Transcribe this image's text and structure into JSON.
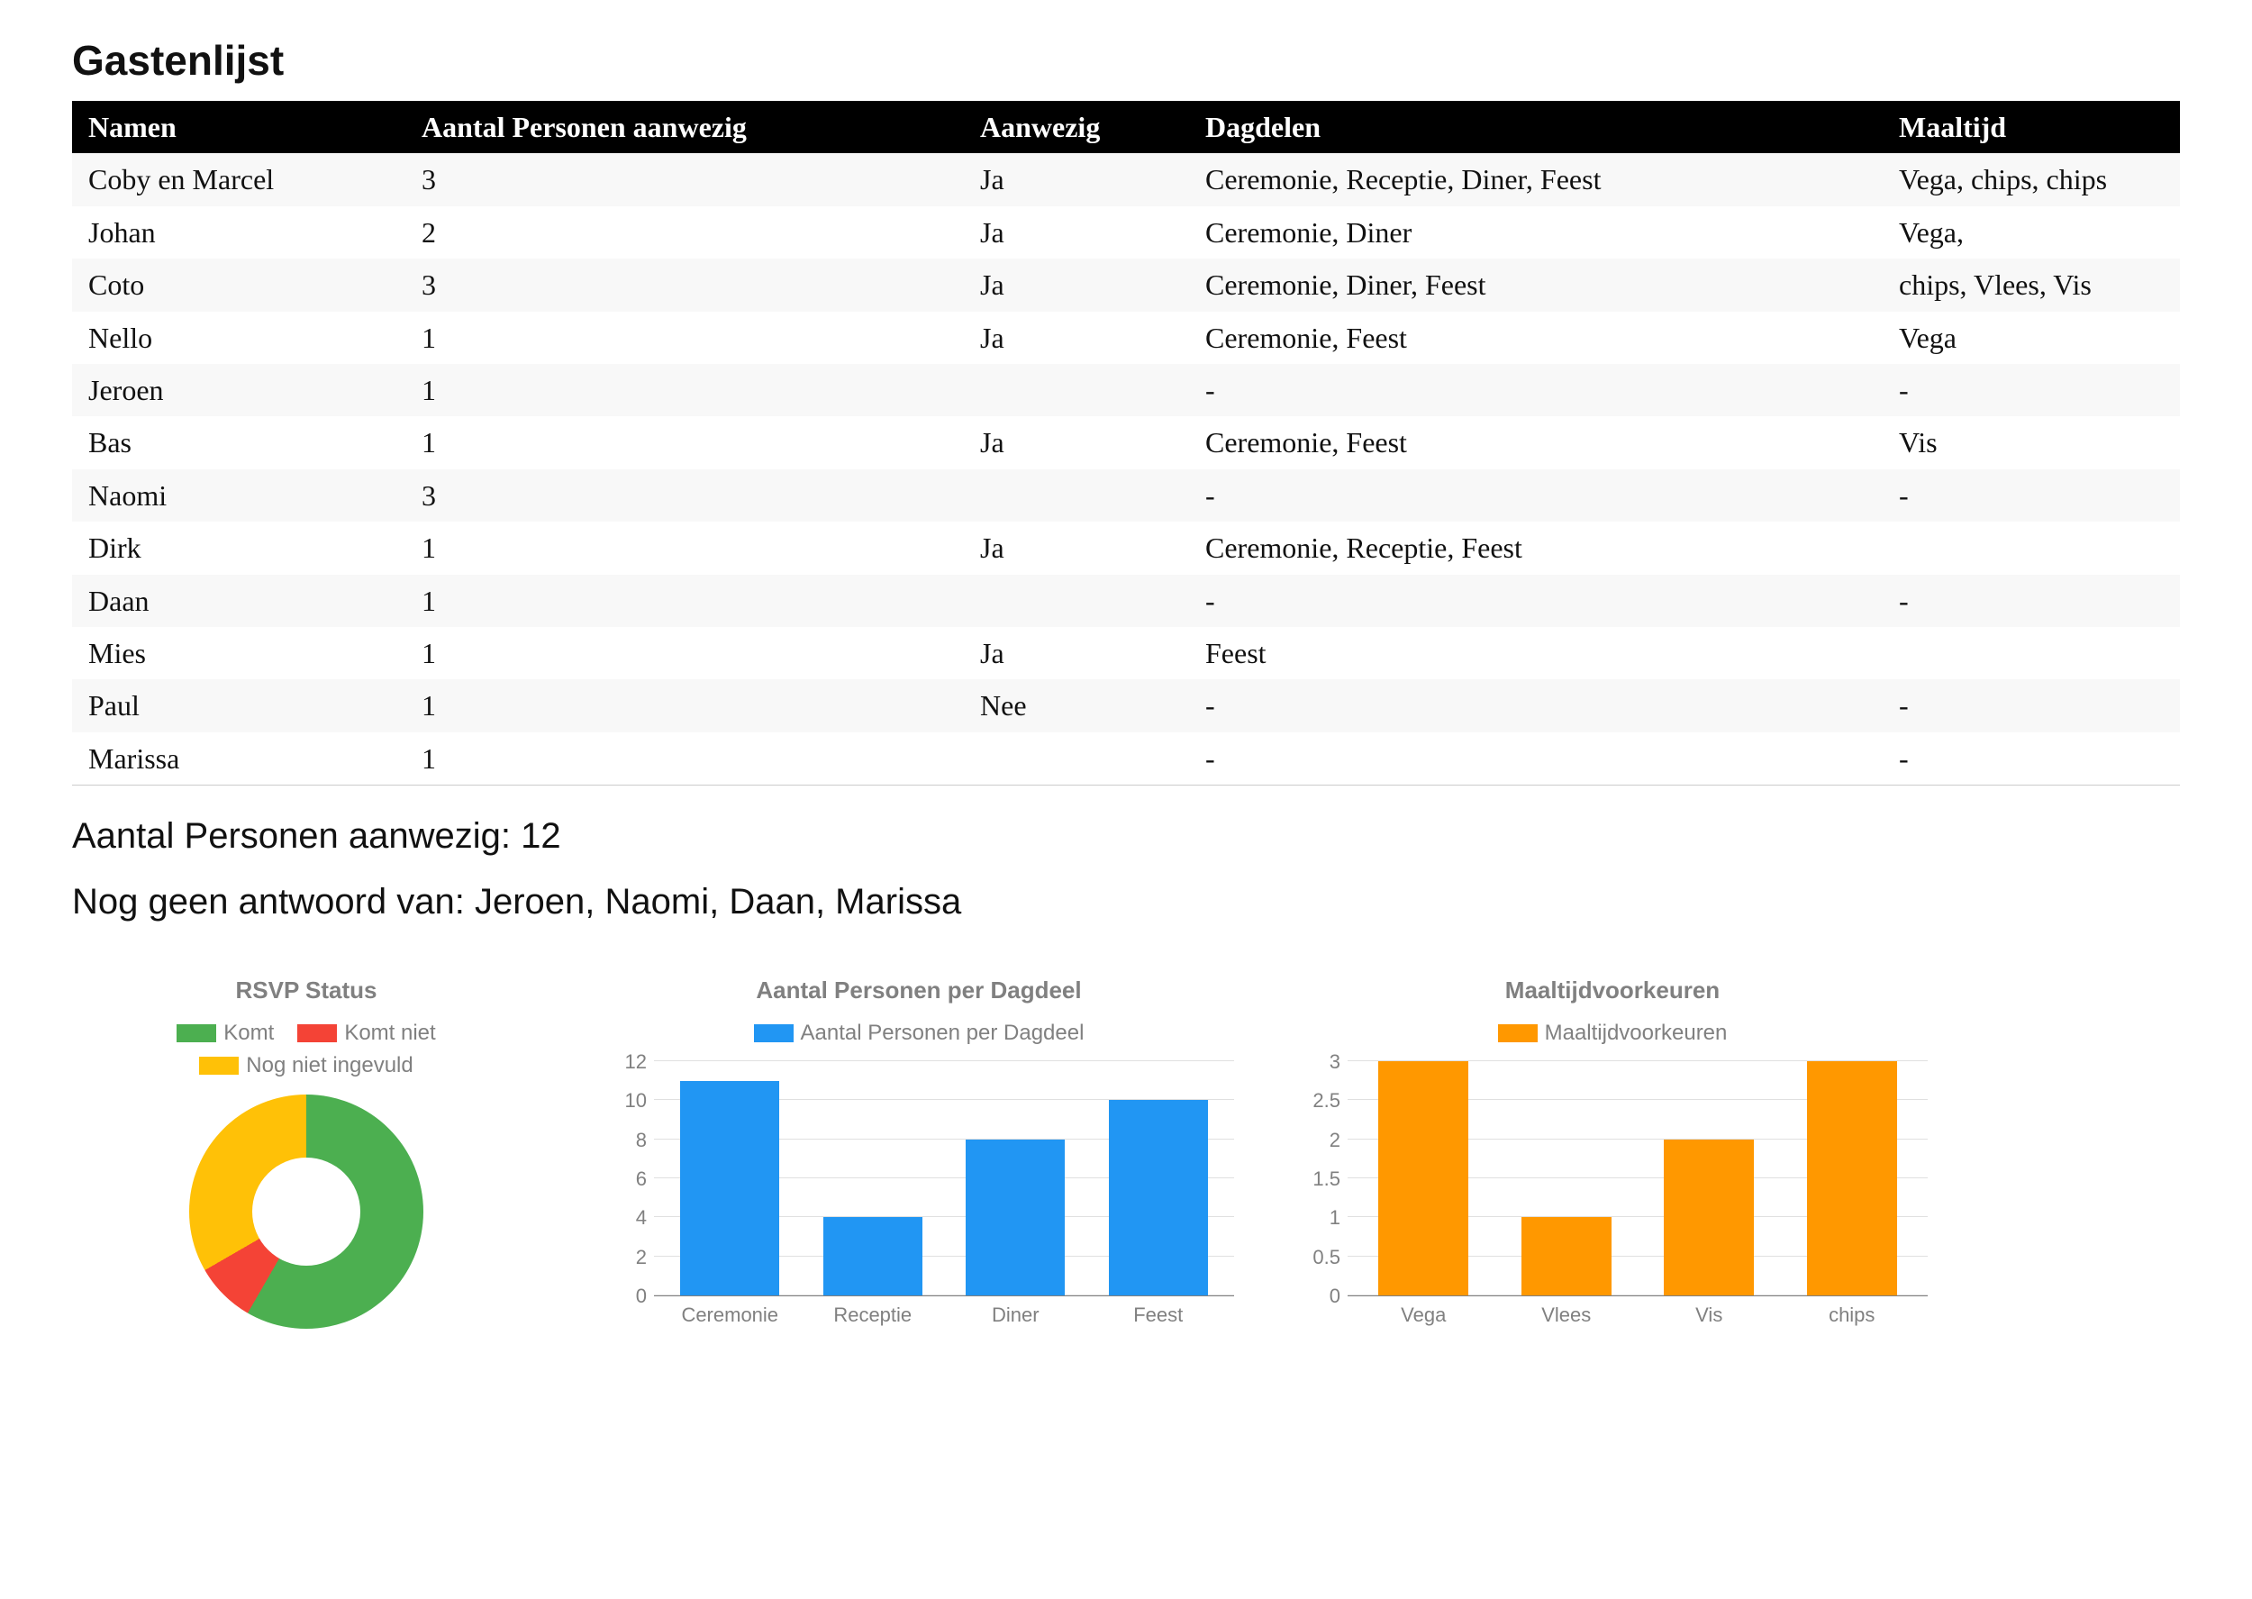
{
  "title": "Gastenlijst",
  "table": {
    "headers": [
      "Namen",
      "Aantal Personen aanwezig",
      "Aanwezig",
      "Dagdelen",
      "Maaltijd"
    ],
    "rows": [
      {
        "naam": "Coby en Marcel",
        "aantal": "3",
        "aanwezig": "Ja",
        "dagdelen": "Ceremonie, Receptie, Diner, Feest",
        "maaltijd": "Vega, chips, chips"
      },
      {
        "naam": "Johan",
        "aantal": "2",
        "aanwezig": "Ja",
        "dagdelen": "Ceremonie, Diner",
        "maaltijd": "Vega,"
      },
      {
        "naam": "Coto",
        "aantal": "3",
        "aanwezig": "Ja",
        "dagdelen": "Ceremonie, Diner, Feest",
        "maaltijd": "chips, Vlees, Vis"
      },
      {
        "naam": "Nello",
        "aantal": "1",
        "aanwezig": "Ja",
        "dagdelen": "Ceremonie, Feest",
        "maaltijd": "Vega"
      },
      {
        "naam": "Jeroen",
        "aantal": "1",
        "aanwezig": "",
        "dagdelen": "-",
        "maaltijd": "-"
      },
      {
        "naam": "Bas",
        "aantal": "1",
        "aanwezig": "Ja",
        "dagdelen": "Ceremonie, Feest",
        "maaltijd": "Vis"
      },
      {
        "naam": "Naomi",
        "aantal": "3",
        "aanwezig": "",
        "dagdelen": "-",
        "maaltijd": "-"
      },
      {
        "naam": "Dirk",
        "aantal": "1",
        "aanwezig": "Ja",
        "dagdelen": "Ceremonie, Receptie, Feest",
        "maaltijd": ""
      },
      {
        "naam": "Daan",
        "aantal": "1",
        "aanwezig": "",
        "dagdelen": "-",
        "maaltijd": "-"
      },
      {
        "naam": "Mies",
        "aantal": "1",
        "aanwezig": "Ja",
        "dagdelen": "Feest",
        "maaltijd": ""
      },
      {
        "naam": "Paul",
        "aantal": "1",
        "aanwezig": "Nee",
        "dagdelen": "-",
        "maaltijd": "-"
      },
      {
        "naam": "Marissa",
        "aantal": "1",
        "aanwezig": "",
        "dagdelen": "-",
        "maaltijd": "-"
      }
    ]
  },
  "summary": {
    "aanwezig_label": "Aantal Personen aanwezig:",
    "aanwezig_value": "12",
    "geen_antwoord_label": "Nog geen antwoord van:",
    "geen_antwoord_names": "Jeroen, Naomi, Daan, Marissa"
  },
  "chart_data": [
    {
      "type": "pie",
      "title": "RSVP Status",
      "series": [
        {
          "name": "Komt",
          "value": 7,
          "color": "#4caf50"
        },
        {
          "name": "Komt niet",
          "value": 1,
          "color": "#f44336"
        },
        {
          "name": "Nog niet ingevuld",
          "value": 4,
          "color": "#ffc107"
        }
      ]
    },
    {
      "type": "bar",
      "title": "Aantal Personen per Dagdeel",
      "legend": "Aantal Personen per Dagdeel",
      "color": "#2196f3",
      "categories": [
        "Ceremonie",
        "Receptie",
        "Diner",
        "Feest"
      ],
      "values": [
        11,
        4,
        8,
        10
      ],
      "yticks": [
        0,
        2,
        4,
        6,
        8,
        10,
        12
      ],
      "ymax": 12
    },
    {
      "type": "bar",
      "title": "Maaltijdvoorkeuren",
      "legend": "Maaltijdvoorkeuren",
      "color": "#ff9800",
      "categories": [
        "Vega",
        "Vlees",
        "Vis",
        "chips"
      ],
      "values": [
        3,
        1,
        2,
        3
      ],
      "yticks": [
        0,
        0.5,
        1.0,
        1.5,
        2.0,
        2.5,
        3.0
      ],
      "ymax": 3.0
    }
  ]
}
